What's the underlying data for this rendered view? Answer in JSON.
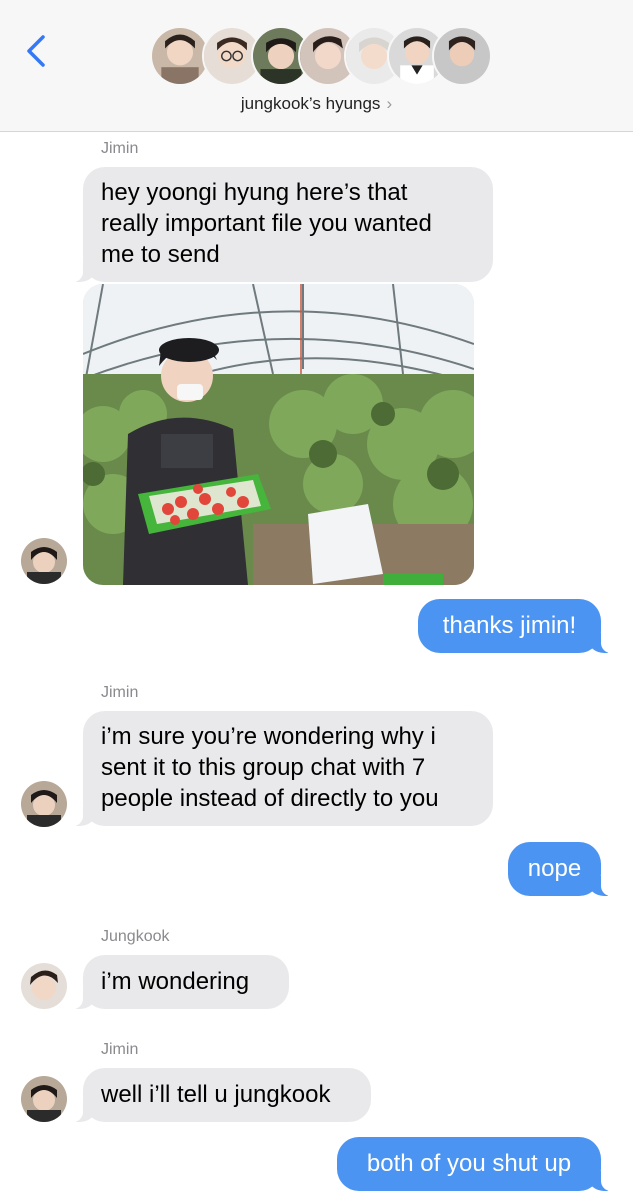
{
  "header": {
    "group_name": "jungkook’s hyungs",
    "chevron": "›",
    "back_icon": "chevron-left-icon",
    "accent": "#3478f6",
    "member_avatar_count": 7
  },
  "messages": [
    {
      "type": "sender",
      "text": "Jimin"
    },
    {
      "type": "incoming",
      "lines": [
        "hey yoongi hyung here’s that",
        "really important file you wanted",
        "me to send"
      ]
    },
    {
      "type": "image",
      "description_hidden": true
    },
    {
      "type": "outgoing",
      "text": "thanks jimin!"
    },
    {
      "type": "sender",
      "text": "Jimin"
    },
    {
      "type": "incoming",
      "lines": [
        "i’m sure you’re wondering why i",
        "sent it to this group chat with 7",
        "people instead of directly to you"
      ]
    },
    {
      "type": "outgoing",
      "text": "nope"
    },
    {
      "type": "sender",
      "text": "Jungkook"
    },
    {
      "type": "incoming",
      "lines": [
        "i’m wondering"
      ]
    },
    {
      "type": "sender",
      "text": "Jimin"
    },
    {
      "type": "incoming",
      "lines": [
        "well i’ll tell u jungkook"
      ]
    },
    {
      "type": "outgoing",
      "text": "both of you shut up"
    }
  ],
  "colors": {
    "incoming_bubble": "#e9e9eb",
    "outgoing_bubble": "#4b94f2",
    "header_bg": "#f7f7f7"
  }
}
